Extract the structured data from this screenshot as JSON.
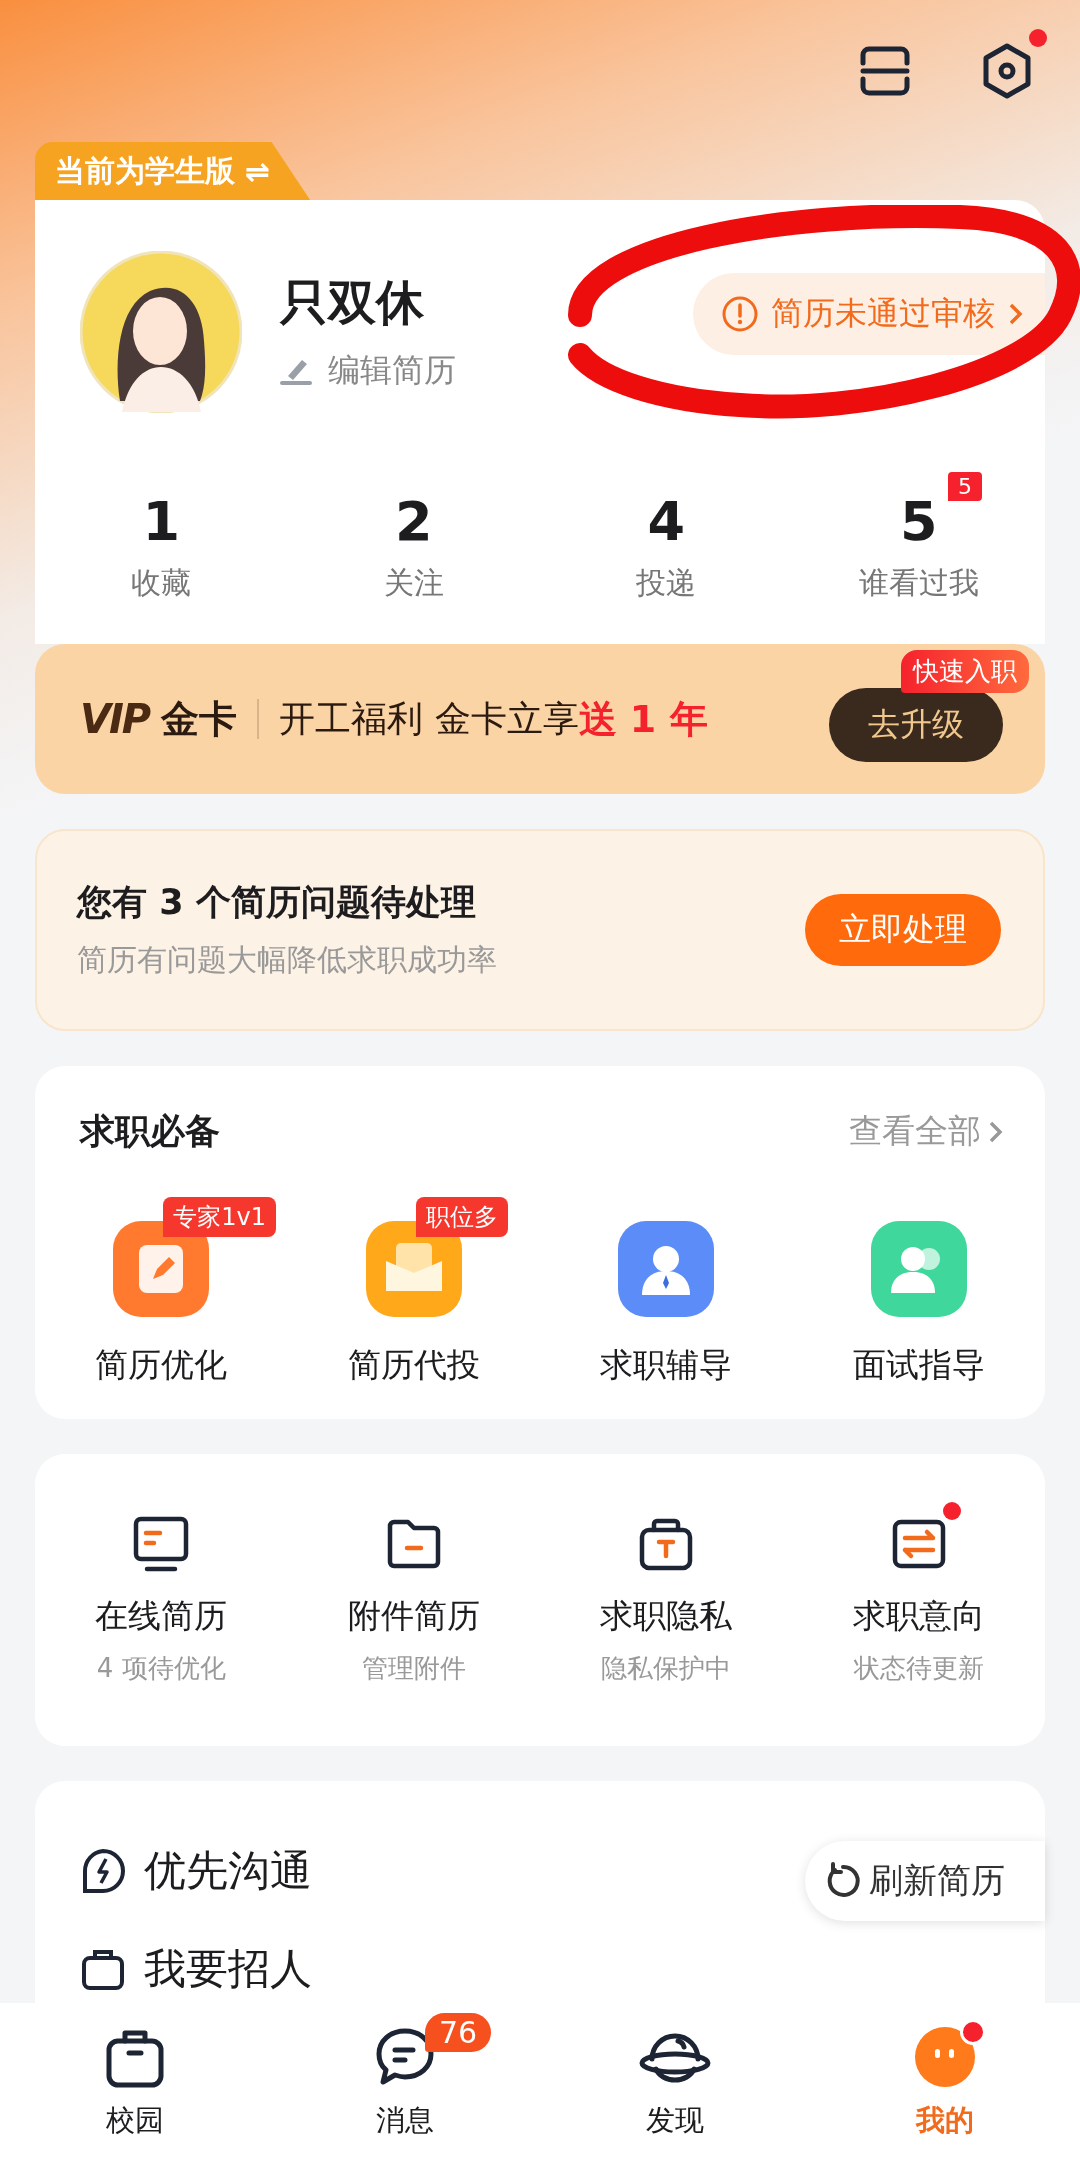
{
  "header": {
    "settings_dot": true
  },
  "edition_tag": {
    "label": "当前为学生版",
    "icon": "⇌"
  },
  "profile": {
    "name": "只双休",
    "edit_label": "编辑简历",
    "review_status": "简历未通过审核"
  },
  "stats": [
    {
      "value": "1",
      "label": "收藏"
    },
    {
      "value": "2",
      "label": "关注"
    },
    {
      "value": "4",
      "label": "投递"
    },
    {
      "value": "5",
      "label": "谁看过我",
      "badge": "5"
    }
  ],
  "vip_banner": {
    "brand": "VIP",
    "card": "金卡",
    "promo": "开工福利 金卡立享",
    "highlight": "送 1 年",
    "button": "去升级",
    "button_badge": "快速入职"
  },
  "resume_issues": {
    "title": "您有 3 个简历问题待处理",
    "subtitle": "简历有问题大幅降低求职成功率",
    "button": "立即处理"
  },
  "job_essentials": {
    "title": "求职必备",
    "more": "查看全部",
    "items": [
      {
        "label": "简历优化",
        "badge": "专家1v1",
        "kind": "pen"
      },
      {
        "label": "简历代投",
        "badge": "职位多",
        "kind": "envelope"
      },
      {
        "label": "求职辅导",
        "kind": "person"
      },
      {
        "label": "面试指导",
        "kind": "people"
      }
    ]
  },
  "resume_tools": [
    {
      "label": "在线简历",
      "sub": "4 项待优化",
      "kind": "monitor",
      "dot": false
    },
    {
      "label": "附件简历",
      "sub": "管理附件",
      "kind": "folder",
      "dot": false
    },
    {
      "label": "求职隐私",
      "sub": "隐私保护中",
      "kind": "lock",
      "dot": false
    },
    {
      "label": "求职意向",
      "sub": "状态待更新",
      "kind": "sliders",
      "dot": true
    }
  ],
  "services": [
    {
      "label": "优先沟通",
      "kind": "bolt",
      "action": "刷新简历"
    },
    {
      "label": "我要招人",
      "kind": "recruit"
    }
  ],
  "tab_bar": [
    {
      "label": "校园",
      "kind": "campus",
      "selected": false,
      "dot": false
    },
    {
      "label": "消息",
      "kind": "chat",
      "selected": false,
      "badge": "76",
      "dot": false
    },
    {
      "label": "发现",
      "kind": "planet",
      "selected": false,
      "dot": false
    },
    {
      "label": "我的",
      "kind": "me",
      "selected": true,
      "dot": true
    }
  ]
}
